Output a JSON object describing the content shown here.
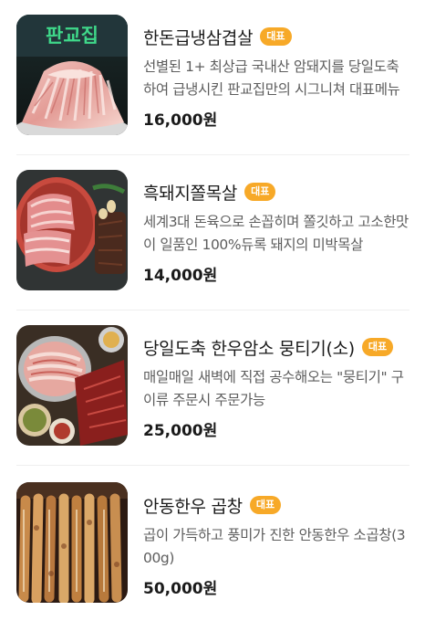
{
  "menu": {
    "items": [
      {
        "name": "한돈급냉삼겹살",
        "badge": "대표",
        "description": "선별된 1+ 최상급 국내산 암돼지를 당일도축하여 급냉시킨 판교집만의 시그니쳐 대표메뉴",
        "price": "16,000원",
        "image_sign_text": "판교집"
      },
      {
        "name": "흑돼지쫄목살",
        "badge": "대표",
        "description": "세계3대 돈육으로 손꼽히며 쫄깃하고 고소한맛이 일품인 100%듀록 돼지의 미박목살",
        "price": "14,000원"
      },
      {
        "name": "당일도축 한우암소 뭉티기(소)",
        "badge": "대표",
        "description": "매일매일 새벽에 직접 공수해오는 \"뭉티기\" 구이류 주문시 주문가능",
        "price": "25,000원"
      },
      {
        "name": "안동한우 곱창",
        "badge": "대표",
        "description": "곱이 가득하고 풍미가 진한 안동한우 소곱창(300g)",
        "price": "50,000원"
      }
    ]
  },
  "colors": {
    "badge": "#f7a928",
    "sign_green": "#3fd88a",
    "divider": "#efefef"
  }
}
